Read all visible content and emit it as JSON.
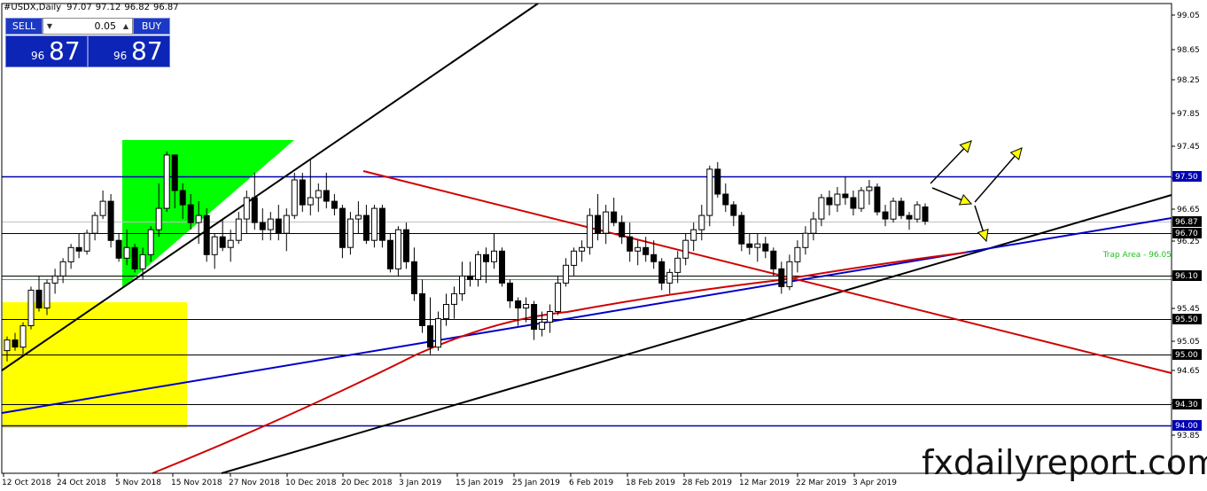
{
  "header": {
    "symbol": "#USDX,Daily",
    "open": "97.07",
    "high": "97.12",
    "low": "96.82",
    "close": "96.87"
  },
  "trade_panel": {
    "sell_label": "SELL",
    "buy_label": "BUY",
    "lot": "0.05",
    "sell_price_small": "96",
    "sell_price_big": "87",
    "buy_price_small": "96",
    "buy_price_big": "87",
    "dropdown_glyph": "▼",
    "up_glyph": "▲"
  },
  "watermark": "fxdailyreport.com",
  "chart_data": {
    "type": "candlestick",
    "ylim": [
      93.75,
      99.2
    ],
    "y_ticks": [
      "99.05",
      "98.65",
      "98.25",
      "97.85",
      "97.45",
      "97.05",
      "96.65",
      "96.25",
      "95.85",
      "95.45",
      "95.05",
      "94.65",
      "94.25",
      "93.85"
    ],
    "x_labels": [
      "12 Oct 2018",
      "24 Oct 2018",
      "5 Nov 2018",
      "15 Nov 2018",
      "27 Nov 2018",
      "10 Dec 2018",
      "20 Dec 2018",
      "3 Jan 2019",
      "15 Jan 2019",
      "25 Jan 2019",
      "6 Feb 2019",
      "18 Feb 2019",
      "28 Feb 2019",
      "12 Mar 2019",
      "22 Mar 2019",
      "3 Apr 2019"
    ],
    "horizontal_levels": [
      {
        "value": 97.5,
        "label": "97.50",
        "color": "#0000b4"
      },
      {
        "value": 96.87,
        "label": "96.87",
        "color": "#c0c0c0"
      },
      {
        "value": 96.7,
        "label": "96.70",
        "color": "#000000"
      },
      {
        "value": 96.1,
        "label": "96.10",
        "color": "#000000"
      },
      {
        "value": 96.05,
        "label": "",
        "color": "#22c022"
      },
      {
        "value": 95.5,
        "label": "95.50",
        "color": "#000000"
      },
      {
        "value": 95.0,
        "label": "95.00",
        "color": "#000000"
      },
      {
        "value": 94.3,
        "label": "94.30",
        "color": "#000000"
      },
      {
        "value": 94.0,
        "label": "94.00",
        "color": "#0000b4"
      }
    ],
    "annotation": "Trap Area - 96.05",
    "candles": [
      [
        95.05,
        95.25,
        94.9,
        95.2
      ],
      [
        95.2,
        95.3,
        95.05,
        95.1
      ],
      [
        95.1,
        95.45,
        95.0,
        95.4
      ],
      [
        95.4,
        95.95,
        95.35,
        95.9
      ],
      [
        95.9,
        96.1,
        95.6,
        95.65
      ],
      [
        95.65,
        96.05,
        95.55,
        96.0
      ],
      [
        96.0,
        96.2,
        95.85,
        96.1
      ],
      [
        96.1,
        96.35,
        96.0,
        96.3
      ],
      [
        96.3,
        96.55,
        96.2,
        96.5
      ],
      [
        96.5,
        96.7,
        96.35,
        96.45
      ],
      [
        96.45,
        96.75,
        96.4,
        96.7
      ],
      [
        96.7,
        97.0,
        96.6,
        96.95
      ],
      [
        96.95,
        97.3,
        96.9,
        97.15
      ],
      [
        97.15,
        97.25,
        96.5,
        96.6
      ],
      [
        96.6,
        96.7,
        96.3,
        96.35
      ],
      [
        96.35,
        96.75,
        96.25,
        96.5
      ],
      [
        96.5,
        96.55,
        96.15,
        96.2
      ],
      [
        96.2,
        96.5,
        96.05,
        96.4
      ],
      [
        96.4,
        96.8,
        96.3,
        96.75
      ],
      [
        96.75,
        97.4,
        96.65,
        97.05
      ],
      [
        97.05,
        97.85,
        97.0,
        97.8
      ],
      [
        97.8,
        97.8,
        97.05,
        97.3
      ],
      [
        97.3,
        97.4,
        96.9,
        97.1
      ],
      [
        97.1,
        97.25,
        96.75,
        96.85
      ],
      [
        96.85,
        97.15,
        96.55,
        96.95
      ],
      [
        96.95,
        97.05,
        96.3,
        96.4
      ],
      [
        96.4,
        96.7,
        96.2,
        96.65
      ],
      [
        96.65,
        96.9,
        96.45,
        96.5
      ],
      [
        96.5,
        96.75,
        96.3,
        96.6
      ],
      [
        96.6,
        97.0,
        96.55,
        96.9
      ],
      [
        96.9,
        97.3,
        96.7,
        97.2
      ],
      [
        97.2,
        97.55,
        96.75,
        96.85
      ],
      [
        96.85,
        97.05,
        96.6,
        96.75
      ],
      [
        96.75,
        97.0,
        96.6,
        96.9
      ],
      [
        96.9,
        97.1,
        96.6,
        96.7
      ],
      [
        96.7,
        97.05,
        96.45,
        96.95
      ],
      [
        96.95,
        97.55,
        96.9,
        97.45
      ],
      [
        97.45,
        97.55,
        97.0,
        97.1
      ],
      [
        97.1,
        97.75,
        96.95,
        97.2
      ],
      [
        97.2,
        97.4,
        97.0,
        97.3
      ],
      [
        97.3,
        97.55,
        97.05,
        97.15
      ],
      [
        97.15,
        97.25,
        96.95,
        97.05
      ],
      [
        97.05,
        97.1,
        96.35,
        96.5
      ],
      [
        96.5,
        97.0,
        96.4,
        96.9
      ],
      [
        96.9,
        97.15,
        96.7,
        96.95
      ],
      [
        96.95,
        97.1,
        96.55,
        96.6
      ],
      [
        96.6,
        97.1,
        96.5,
        97.05
      ],
      [
        97.05,
        97.1,
        96.5,
        96.6
      ],
      [
        96.6,
        96.7,
        96.15,
        96.2
      ],
      [
        96.2,
        96.8,
        96.1,
        96.75
      ],
      [
        96.75,
        96.85,
        96.2,
        96.3
      ],
      [
        96.3,
        96.5,
        95.75,
        95.85
      ],
      [
        95.85,
        96.05,
        95.3,
        95.4
      ],
      [
        95.4,
        95.8,
        95.0,
        95.1
      ],
      [
        95.1,
        95.6,
        95.05,
        95.5
      ],
      [
        95.5,
        95.85,
        95.4,
        95.7
      ],
      [
        95.7,
        95.95,
        95.5,
        95.85
      ],
      [
        95.85,
        96.3,
        95.75,
        96.1
      ],
      [
        96.1,
        96.3,
        95.95,
        96.05
      ],
      [
        96.05,
        96.45,
        95.95,
        96.4
      ],
      [
        96.4,
        96.5,
        96.0,
        96.3
      ],
      [
        96.3,
        96.7,
        96.2,
        96.45
      ],
      [
        96.45,
        96.5,
        95.95,
        96.0
      ],
      [
        96.0,
        96.05,
        95.65,
        95.75
      ],
      [
        95.75,
        95.8,
        95.4,
        95.65
      ],
      [
        95.65,
        95.8,
        95.45,
        95.7
      ],
      [
        95.7,
        95.75,
        95.2,
        95.35
      ],
      [
        95.35,
        95.6,
        95.25,
        95.45
      ],
      [
        95.45,
        95.7,
        95.3,
        95.6
      ],
      [
        95.6,
        96.1,
        95.55,
        96.0
      ],
      [
        96.0,
        96.35,
        95.95,
        96.25
      ],
      [
        96.25,
        96.5,
        96.1,
        96.45
      ],
      [
        96.45,
        96.6,
        96.3,
        96.5
      ],
      [
        96.5,
        97.05,
        96.4,
        96.95
      ],
      [
        96.95,
        97.25,
        96.6,
        96.7
      ],
      [
        96.7,
        97.1,
        96.55,
        97.0
      ],
      [
        97.0,
        97.2,
        96.8,
        96.85
      ],
      [
        96.85,
        96.95,
        96.55,
        96.65
      ],
      [
        96.65,
        96.85,
        96.3,
        96.45
      ],
      [
        96.45,
        96.6,
        96.25,
        96.5
      ],
      [
        96.5,
        96.65,
        96.3,
        96.4
      ],
      [
        96.4,
        96.6,
        96.2,
        96.3
      ],
      [
        96.3,
        96.35,
        95.9,
        96.0
      ],
      [
        96.0,
        96.2,
        95.85,
        96.15
      ],
      [
        96.15,
        96.45,
        96.0,
        96.35
      ],
      [
        96.35,
        96.7,
        96.25,
        96.6
      ],
      [
        96.6,
        96.85,
        96.45,
        96.75
      ],
      [
        96.75,
        97.1,
        96.6,
        96.95
      ],
      [
        96.95,
        97.65,
        96.8,
        97.6
      ],
      [
        97.6,
        97.7,
        97.2,
        97.25
      ],
      [
        97.25,
        97.4,
        97.0,
        97.1
      ],
      [
        97.1,
        97.15,
        96.8,
        96.95
      ],
      [
        96.95,
        97.0,
        96.45,
        96.55
      ],
      [
        96.55,
        96.7,
        96.4,
        96.5
      ],
      [
        96.5,
        96.7,
        96.3,
        96.55
      ],
      [
        96.55,
        96.65,
        96.35,
        96.45
      ],
      [
        96.45,
        96.5,
        96.1,
        96.2
      ],
      [
        96.2,
        96.3,
        95.85,
        95.95
      ],
      [
        95.95,
        96.4,
        95.9,
        96.3
      ],
      [
        96.3,
        96.6,
        96.15,
        96.5
      ],
      [
        96.5,
        96.8,
        96.4,
        96.7
      ],
      [
        96.7,
        97.0,
        96.6,
        96.9
      ],
      [
        96.9,
        97.25,
        96.8,
        97.2
      ],
      [
        97.2,
        97.3,
        96.95,
        97.1
      ],
      [
        97.1,
        97.35,
        97.0,
        97.25
      ],
      [
        97.25,
        97.5,
        97.1,
        97.2
      ],
      [
        97.2,
        97.3,
        96.95,
        97.05
      ],
      [
        97.05,
        97.35,
        97.0,
        97.3
      ],
      [
        97.3,
        97.45,
        97.1,
        97.35
      ],
      [
        97.35,
        97.4,
        96.95,
        97.0
      ],
      [
        97.0,
        97.1,
        96.8,
        96.9
      ],
      [
        96.9,
        97.2,
        96.85,
        97.15
      ],
      [
        97.15,
        97.2,
        96.9,
        96.95
      ],
      [
        96.95,
        97.0,
        96.75,
        96.9
      ],
      [
        96.9,
        97.15,
        96.85,
        97.1
      ],
      [
        97.07,
        97.12,
        96.82,
        96.87
      ]
    ]
  }
}
